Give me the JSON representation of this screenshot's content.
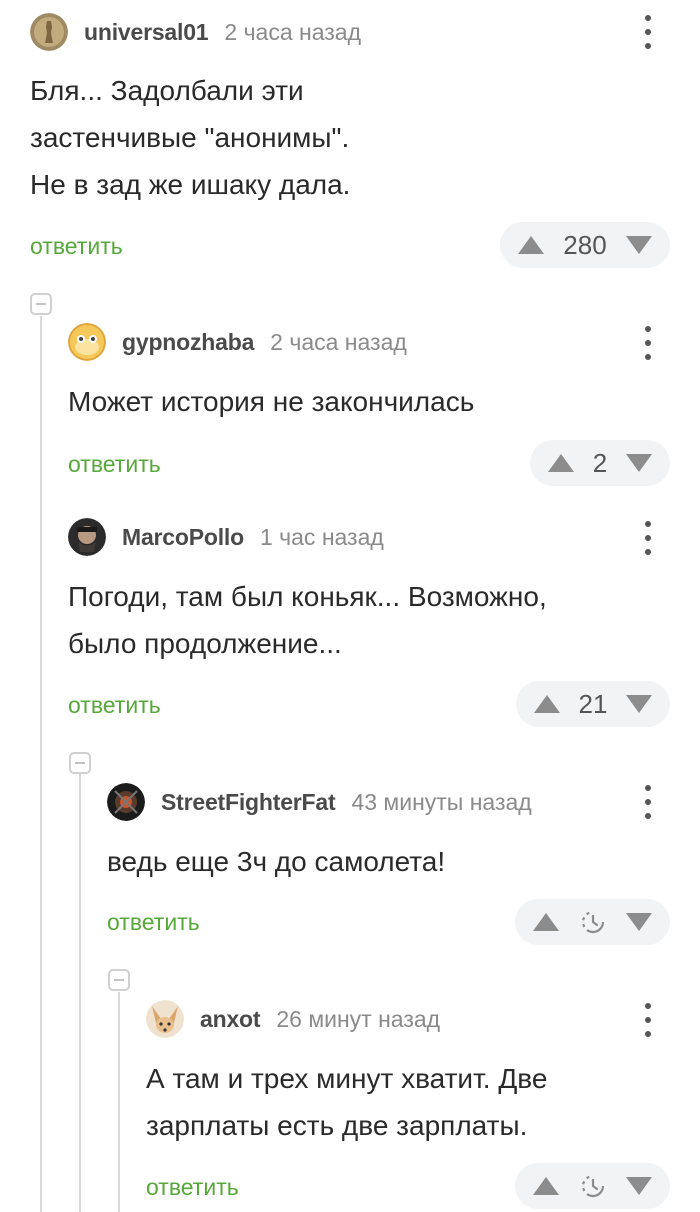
{
  "comments": [
    {
      "username": "universal01",
      "time": "2 часа назад",
      "lines": [
        "Бля... Задолбали эти",
        "застенчивые \"анонимы\".",
        "Не в зад же ишаку дала."
      ],
      "reply_label": "ответить",
      "rating": "280",
      "avatar_icon": "coin-statue-avatar"
    },
    {
      "username": "gypnozhaba",
      "time": "2 часа назад",
      "lines": [
        "Может история не закончилась"
      ],
      "reply_label": "ответить",
      "rating": "2",
      "avatar_icon": "toad-face-avatar"
    },
    {
      "username": "MarcoPollo",
      "time": "1 час назад",
      "lines": [
        "Погоди, там был коньяк... Возможно,",
        "было продолжение..."
      ],
      "reply_label": "ответить",
      "rating": "21",
      "avatar_icon": "bearded-man-avatar"
    },
    {
      "username": "StreetFighterFat",
      "time": "43 минуты назад",
      "lines": [
        "ведь еще 3ч до самолета!"
      ],
      "reply_label": "ответить",
      "rating": null,
      "avatar_icon": "dark-emblem-avatar"
    },
    {
      "username": "anxot",
      "time": "26 минут назад",
      "lines": [
        "А там и трех минут хватит. Две",
        "зарплаты есть две зарплаты."
      ],
      "reply_label": "ответить",
      "rating": null,
      "avatar_icon": "fennec-fox-avatar"
    }
  ],
  "icons": {
    "upvote": "triangle-up-icon",
    "downvote": "triangle-down-icon",
    "pending": "clock-icon",
    "menu": "more-vertical-icon",
    "collapse": "collapse-thread-icon"
  },
  "colors": {
    "reply": "#57a83b",
    "rating_bg": "#f2f3f5",
    "muted": "#8a8a8a"
  }
}
